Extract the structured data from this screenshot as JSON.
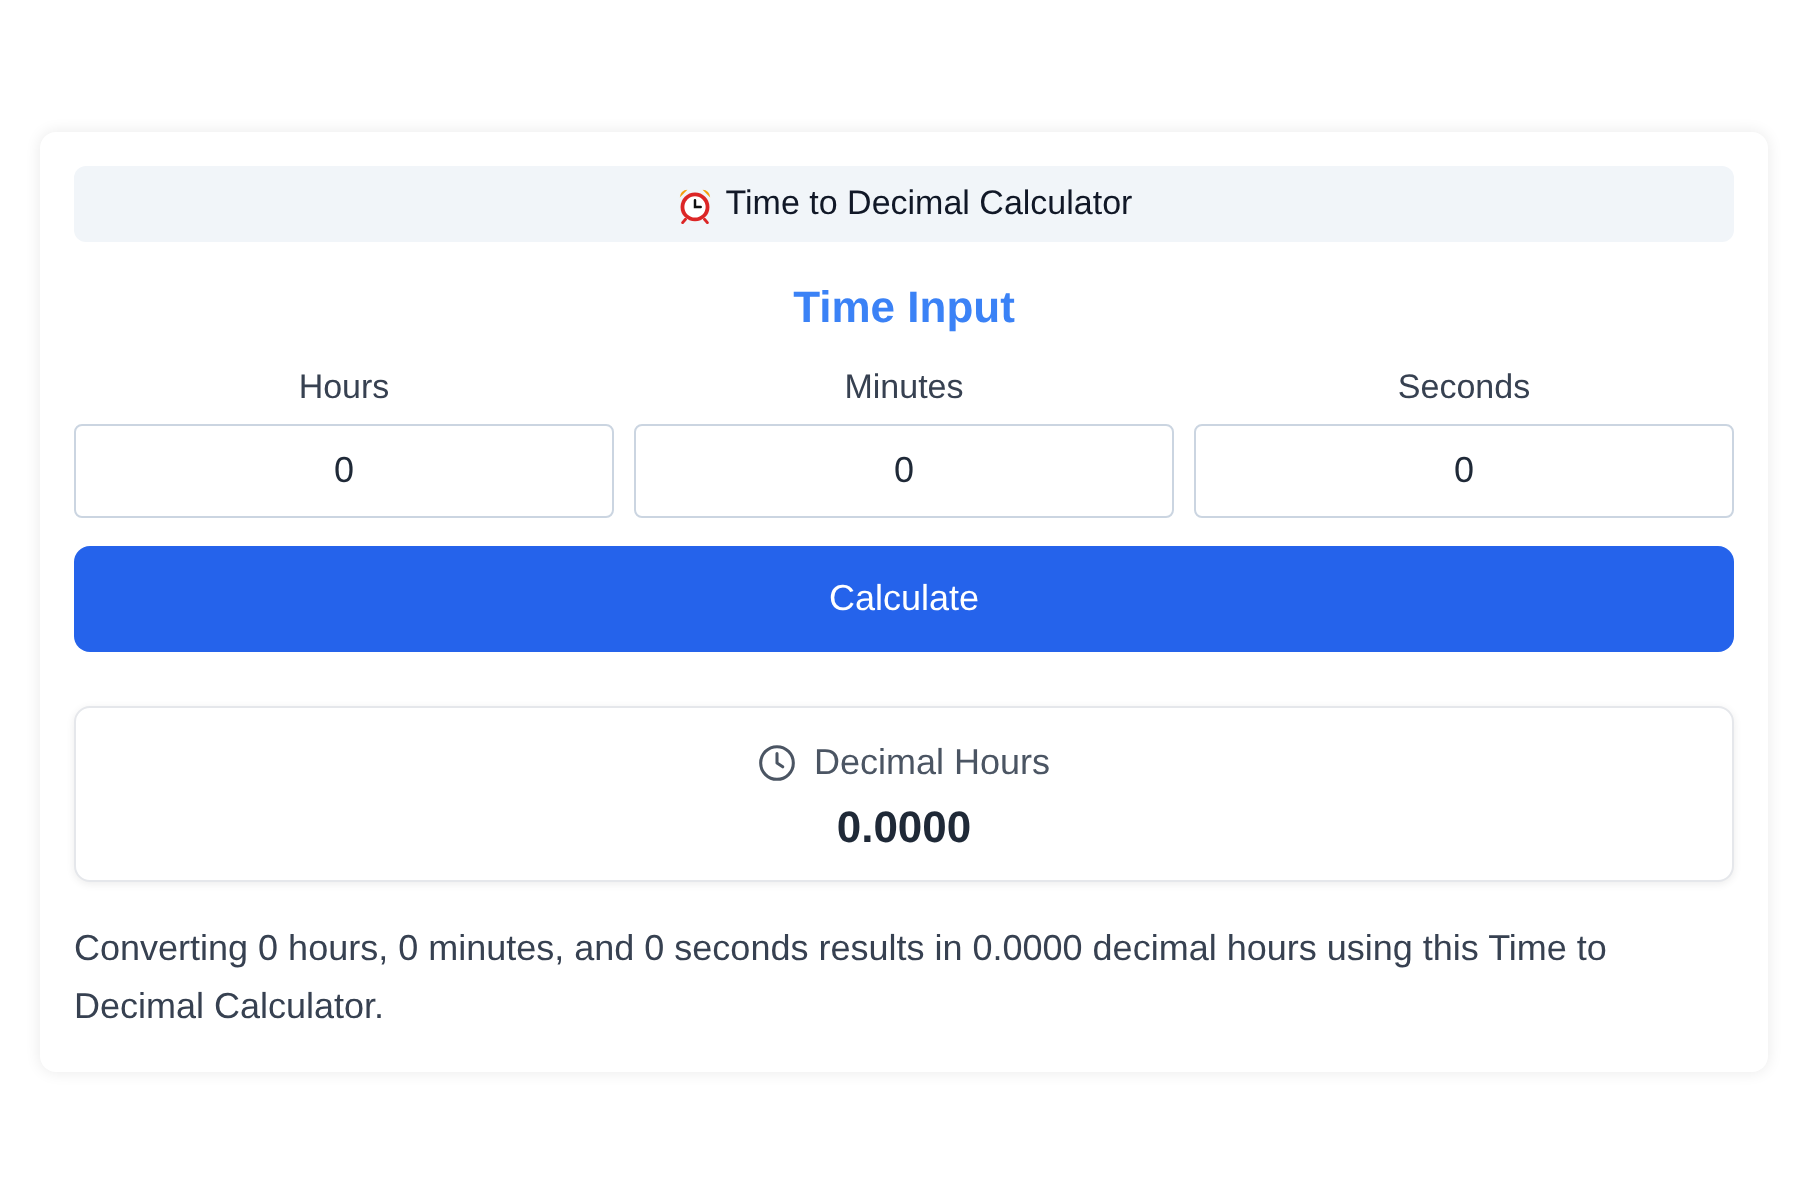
{
  "header": {
    "title": "Time to Decimal Calculator"
  },
  "section_title": "Time Input",
  "fields": [
    {
      "label": "Hours",
      "value": "0"
    },
    {
      "label": "Minutes",
      "value": "0"
    },
    {
      "label": "Seconds",
      "value": "0"
    }
  ],
  "button": {
    "label": "Calculate"
  },
  "result": {
    "label": "Decimal Hours",
    "value": "0.0000"
  },
  "summary": "Converting 0 hours, 0 minutes, and 0 seconds results in 0.0000 decimal hours using this Time to Decimal Calculator."
}
